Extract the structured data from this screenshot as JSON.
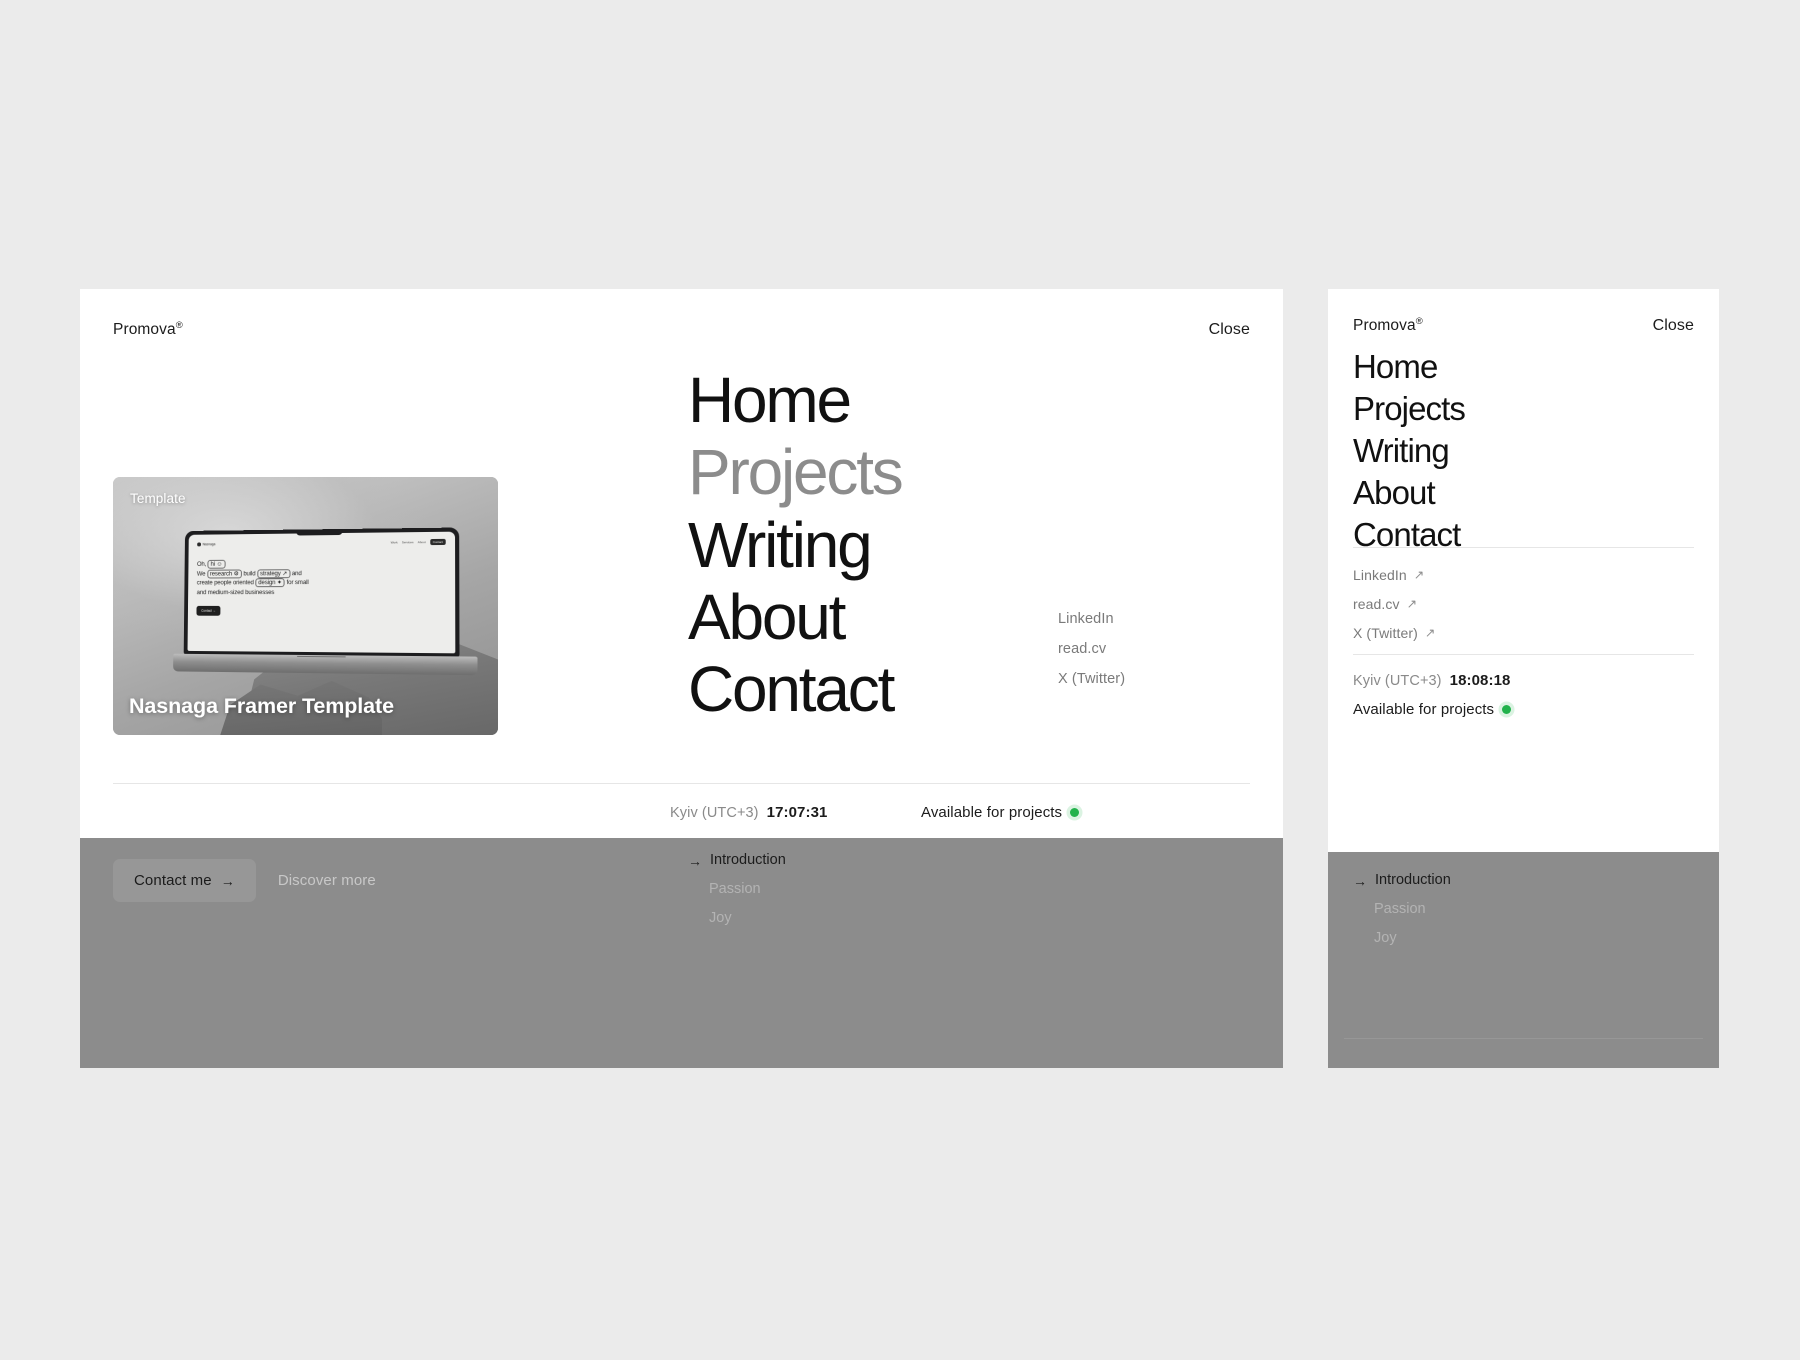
{
  "canvas": {
    "background": "#ebebeb"
  },
  "desktop": {
    "header": {
      "brand": "Promova",
      "brand_mark": "®",
      "close_label": "Close"
    },
    "card": {
      "tag": "Template",
      "title": "Nasnaga Framer Template",
      "screen": {
        "logo": "Nasnaga",
        "nav": [
          "Work",
          "Services",
          "About"
        ],
        "nav_cta": "Contact",
        "line1_a": "Oh,",
        "line1_box": "hi ☺",
        "line2_a": "We",
        "line2_box1": "research ⚙",
        "line2_b": "build",
        "line2_box2": "strategy ↗",
        "line2_c": "and",
        "line3_a": "create people oriented",
        "line3_box": "design ✦",
        "line3_b": "for small",
        "line4": "and medium-sized businesses",
        "cta": "Contact →"
      }
    },
    "nav": [
      {
        "label": "Home",
        "state": "default"
      },
      {
        "label": "Projects",
        "state": "muted"
      },
      {
        "label": "Writing",
        "state": "default"
      },
      {
        "label": "About",
        "state": "default"
      },
      {
        "label": "Contact",
        "state": "default"
      }
    ],
    "links": [
      {
        "label": "LinkedIn"
      },
      {
        "label": "read.cv"
      },
      {
        "label": "X (Twitter)"
      }
    ],
    "status": {
      "timezone": "Kyiv (UTC+3)",
      "time": "17:07:31",
      "availability": "Available for projects",
      "availability_color": "#22b24c"
    },
    "grey": {
      "contact_button": "Contact me",
      "contact_arrow": "→",
      "discover_link": "Discover more",
      "toc": [
        {
          "label": "Introduction",
          "state": "active",
          "arrow": "→"
        },
        {
          "label": "Passion",
          "state": "dim"
        },
        {
          "label": "Joy",
          "state": "dim"
        }
      ]
    }
  },
  "mobile": {
    "header": {
      "brand": "Promova",
      "brand_mark": "®",
      "close_label": "Close"
    },
    "nav": [
      {
        "label": "Home"
      },
      {
        "label": "Projects"
      },
      {
        "label": "Writing"
      },
      {
        "label": "About"
      },
      {
        "label": "Contact"
      }
    ],
    "links": [
      {
        "label": "LinkedIn",
        "icon": "↗"
      },
      {
        "label": "read.cv",
        "icon": "↗"
      },
      {
        "label": "X (Twitter)",
        "icon": "↗"
      }
    ],
    "status": {
      "timezone": "Kyiv (UTC+3)",
      "time": "18:08:18",
      "availability": "Available for projects",
      "availability_color": "#22b24c"
    },
    "grey": {
      "toc": [
        {
          "label": "Introduction",
          "state": "active",
          "arrow": "→"
        },
        {
          "label": "Passion",
          "state": "dim"
        },
        {
          "label": "Joy",
          "state": "dim"
        }
      ]
    }
  }
}
